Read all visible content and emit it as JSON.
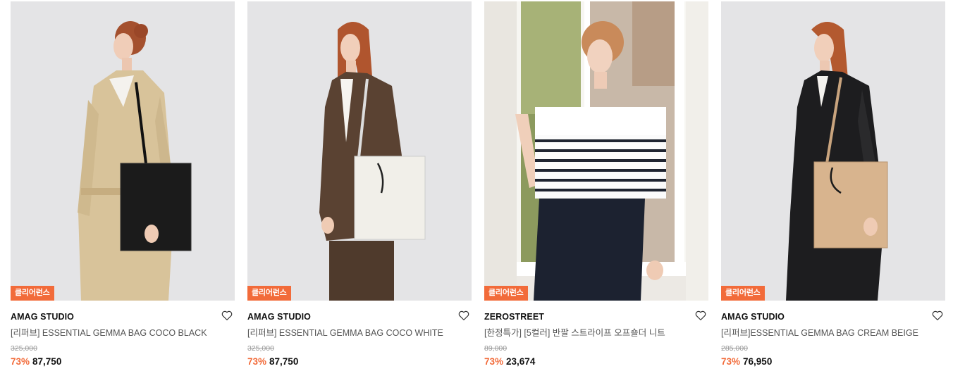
{
  "products": [
    {
      "badge": "클리어런스",
      "brand": "AMAG STUDIO",
      "name": "[리퍼브] ESSENTIAL GEMMA BAG COCO BLACK",
      "original_price": "325,000",
      "discount": "73%",
      "price": "87,750",
      "wishlist_icon": "heart-outline-icon"
    },
    {
      "badge": "클리어런스",
      "brand": "AMAG STUDIO",
      "name": "[리퍼브] ESSENTIAL GEMMA BAG COCO WHITE",
      "original_price": "325,000",
      "discount": "73%",
      "price": "87,750",
      "wishlist_icon": "heart-outline-icon"
    },
    {
      "badge": "클리어런스",
      "brand": "ZEROSTREET",
      "name": "[한정특가] [5컬러] 반팔 스트라이프 오프숄더 니트",
      "original_price": "89,000",
      "discount": "73%",
      "price": "23,674",
      "wishlist_icon": "heart-outline-icon"
    },
    {
      "badge": "클리어런스",
      "brand": "AMAG STUDIO",
      "name": "[리퍼브]ESSENTIAL GEMMA BAG CREAM BEIGE",
      "original_price": "285,000",
      "discount": "73%",
      "price": "76,950",
      "wishlist_icon": "heart-outline-icon"
    }
  ],
  "colors": {
    "badge_bg": "#f26b3a",
    "discount": "#f26b3a",
    "photo_bg": "#e6e6e8"
  }
}
